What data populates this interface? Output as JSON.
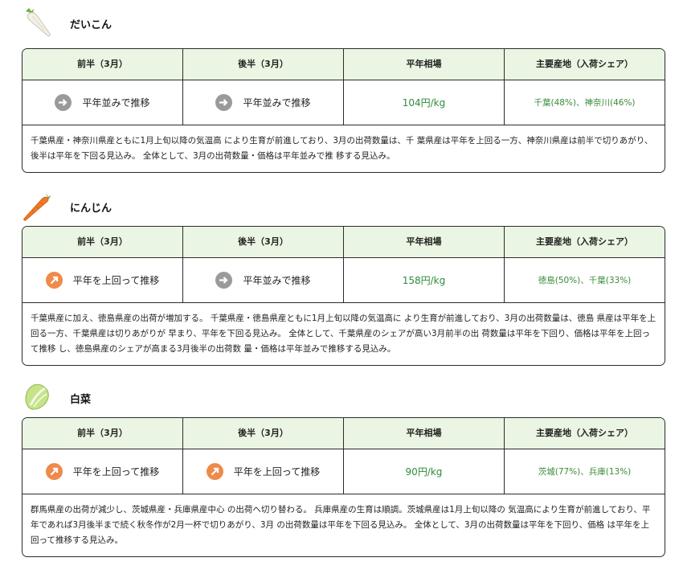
{
  "columns": {
    "first_half": "前半（3月）",
    "second_half": "後半（3月）",
    "avg_price": "平年相場",
    "origins": "主要産地（入荷シェア）"
  },
  "colors": {
    "header_bg": "#eaf6e3",
    "flat_arrow": "#9a9a9a",
    "up_arrow": "#ef8a4c",
    "price_text": "#2e8b3a"
  },
  "items": [
    {
      "name": "だいこん",
      "icon": "daikon-icon",
      "first_half": {
        "icon": "flat-arrow-icon",
        "label": "平年並みで推移"
      },
      "second_half": {
        "icon": "flat-arrow-icon",
        "label": "平年並みで推移"
      },
      "avg_price": "104円/kg",
      "origins": "千葉(48%)、神奈川(46%)",
      "description": "千葉県産・神奈川県産ともに1月上旬以降の気温高 により生育が前進しており、3月の出荷数量は、千 葉県産は平年を上回る一方、神奈川県産は前半で切りあがり、後半は平年を下回る見込み。 全体として、3月の出荷数量・価格は平年並みで推 移する見込み。"
    },
    {
      "name": "にんじん",
      "icon": "carrot-icon",
      "first_half": {
        "icon": "up-arrow-icon",
        "label": "平年を上回って推移"
      },
      "second_half": {
        "icon": "flat-arrow-icon",
        "label": "平年並みで推移"
      },
      "avg_price": "158円/kg",
      "origins": "徳島(50%)、千葉(33%)",
      "description": "千葉県産に加え、徳島県産の出荷が増加する。 千葉県産・徳島県産ともに1月上旬以降の気温高に より生育が前進しており、3月の出荷数量は、徳島 県産は平年を上回る一方、千葉県産は切りあがりが 早まり、平年を下回る見込み。 全体として、千葉県産のシェアが高い3月前半の出 荷数量は平年を下回り、価格は平年を上回って推移 し、徳島県産のシェアが高まる3月後半の出荷数 量・価格は平年並みで推移する見込み。"
    },
    {
      "name": "白菜",
      "icon": "hakusai-icon",
      "first_half": {
        "icon": "up-arrow-icon",
        "label": "平年を上回って推移"
      },
      "second_half": {
        "icon": "up-arrow-icon",
        "label": "平年を上回って推移"
      },
      "avg_price": "90円/kg",
      "origins": "茨城(77%)、兵庫(13%)",
      "description": "群馬県産の出荷が減少し、茨城県産・兵庫県産中心 の出荷へ切り替わる。 兵庫県産の生育は順調。茨城県産は1月上旬以降の 気温高により生育が前進しており、平年であれば3月後半まで続く秋冬作が2月一杯で切りあがり、3月 の出荷数量は平年を下回る見込み。 全体として、3月の出荷数量は平年を下回り、価格 は平年を上回って推移する見込み。"
    }
  ]
}
